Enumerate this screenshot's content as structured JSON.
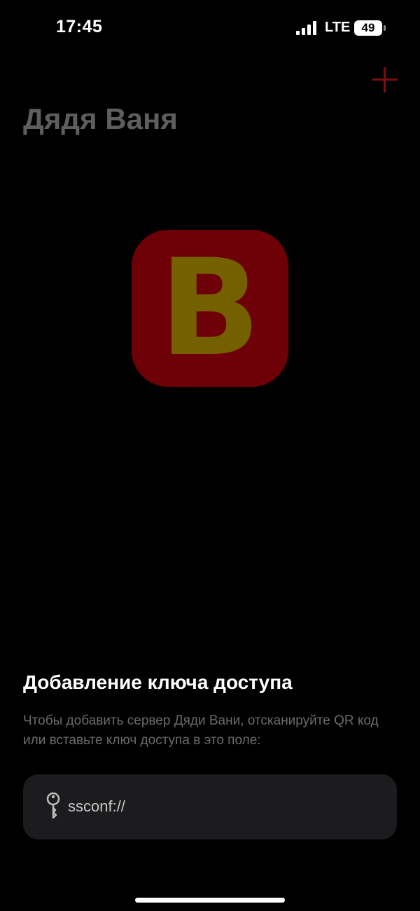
{
  "status_bar": {
    "time": "17:45",
    "network": "LTE",
    "battery": "49",
    "icons": [
      "signal-icon",
      "battery-icon"
    ]
  },
  "header": {
    "title": "Дядя Ваня",
    "add_icon": "plus-icon",
    "accent_color": "#7d0e0e"
  },
  "logo": {
    "letter": "B",
    "background_color": "#6e0007",
    "letter_color": "#756000"
  },
  "access_key": {
    "heading": "Добавление ключа доступа",
    "description": "Чтобы добавить сервер Дяди Вани, отсканируйте QR код или вставьте ключ доступа в это поле:",
    "input_value": "ssconf://",
    "input_icon": "key-icon"
  }
}
